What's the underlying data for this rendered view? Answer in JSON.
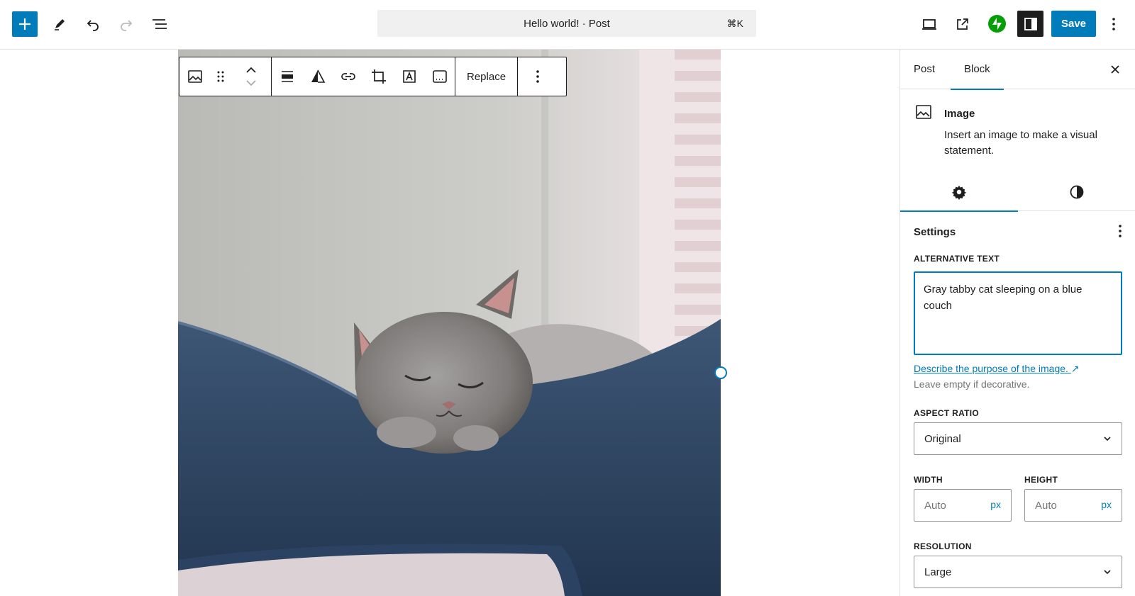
{
  "topbar": {
    "command_title": "Hello world! · Post",
    "command_shortcut": "⌘K",
    "save_label": "Save",
    "icons": [
      "plus-icon",
      "pen-icon",
      "undo-icon",
      "redo-icon",
      "list-view-icon",
      "desktop-preview-icon",
      "external-link-icon",
      "jetpack-icon",
      "sidebar-toggle-icon",
      "more-vertical-icon"
    ]
  },
  "block_toolbar": {
    "replace_label": "Replace",
    "icons": [
      "image-icon",
      "drag-handle-icon",
      "move-up-icon",
      "move-down-icon",
      "align-icon",
      "duotone-icon",
      "link-icon",
      "crop-icon",
      "text-overlay-icon",
      "caption-icon",
      "more-vertical-icon"
    ]
  },
  "sidebar": {
    "tabs": [
      {
        "label": "Post",
        "active": false
      },
      {
        "label": "Block",
        "active": true
      }
    ],
    "block": {
      "title": "Image",
      "description": "Insert an image to make a visual statement."
    },
    "sub_tabs": [
      "settings-gear-icon",
      "styles-contrast-icon"
    ],
    "settings": {
      "title": "Settings",
      "alt_label": "ALTERNATIVE TEXT",
      "alt_value": "Gray tabby cat sleeping on a blue couch",
      "alt_link": "Describe the purpose of the image.",
      "alt_hint": "Leave empty if decorative.",
      "aspect_label": "ASPECT RATIO",
      "aspect_value": "Original",
      "width_label": "WIDTH",
      "width_placeholder": "Auto",
      "height_label": "HEIGHT",
      "height_placeholder": "Auto",
      "unit": "px",
      "resolution_label": "RESOLUTION",
      "resolution_value": "Large"
    }
  },
  "colors": {
    "accent": "#007cba",
    "dark": "#1e1e1e",
    "jetpack_green": "#069e08"
  }
}
